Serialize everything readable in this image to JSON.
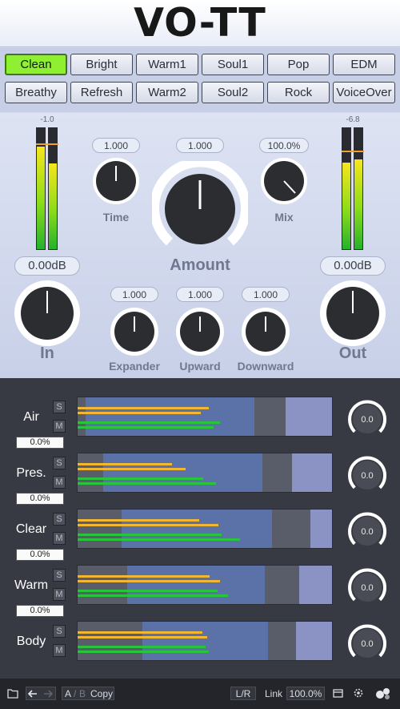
{
  "app": {
    "title": "VO-TT"
  },
  "presets": {
    "row1": [
      "Clean",
      "Bright",
      "Warm1",
      "Soul1",
      "Pop",
      "EDM"
    ],
    "row2": [
      "Breathy",
      "Refresh",
      "Warm2",
      "Soul2",
      "Rock",
      "VoiceOver"
    ],
    "active": "Clean"
  },
  "meters": {
    "in_peak": "-1.0",
    "out_peak": "-6.8",
    "in_levels": [
      0.72,
      0.76
    ],
    "out_levels": [
      0.74,
      0.78
    ]
  },
  "knobs": {
    "time": {
      "label": "Time",
      "value": "1.000"
    },
    "amount": {
      "label": "Amount",
      "value": "1.000"
    },
    "mix": {
      "label": "Mix",
      "value": "100.0%"
    },
    "input": {
      "label": "In",
      "value": "0.00dB"
    },
    "output": {
      "label": "Out",
      "value": "0.00dB"
    },
    "expander": {
      "label": "Expander",
      "value": "1.000"
    },
    "upward": {
      "label": "Upward",
      "value": "1.000"
    },
    "downward": {
      "label": "Downward",
      "value": "1.000"
    }
  },
  "bands": [
    {
      "name": "Air",
      "solo": "S",
      "mute": "M",
      "percent": "0.0%",
      "knob": "0.0"
    },
    {
      "name": "Pres.",
      "solo": "S",
      "mute": "M",
      "percent": "0.0%",
      "knob": "0.0"
    },
    {
      "name": "Clear",
      "solo": "S",
      "mute": "M",
      "percent": "0.0%",
      "knob": "0.0"
    },
    {
      "name": "Warm",
      "solo": "S",
      "mute": "M",
      "percent": "0.0%",
      "knob": "0.0"
    },
    {
      "name": "Body",
      "solo": "S",
      "mute": "M",
      "knob": "0.0"
    }
  ],
  "footer": {
    "ab_a": "A",
    "ab_sep": "/",
    "ab_b": "B",
    "copy": "Copy",
    "lr": "L/R",
    "link_label": "Link",
    "link_value": "100.0%"
  },
  "colors": {
    "active_preset": "#8ef031",
    "meter_yellow": "#f2b632",
    "meter_green": "#27c43c",
    "band_blue": "#5b72a8"
  }
}
